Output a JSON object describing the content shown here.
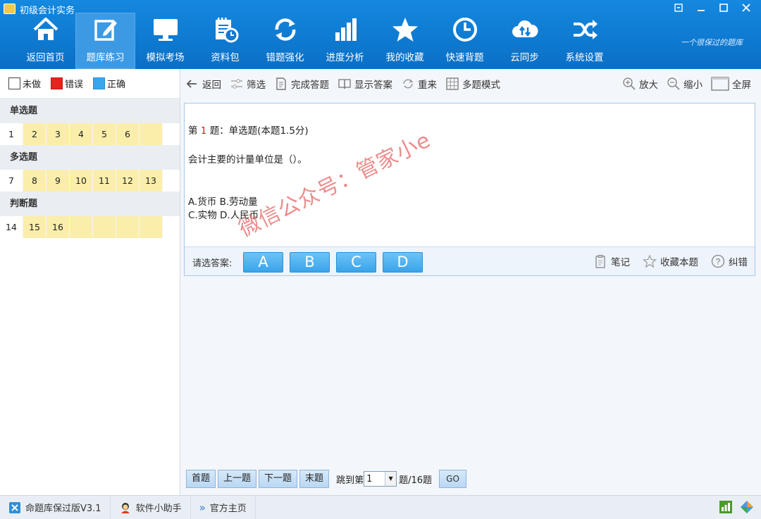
{
  "window": {
    "title": "初级会计实务",
    "controls": [
      "restore-down-icon",
      "minimize-icon",
      "maximize-icon",
      "close-icon"
    ]
  },
  "nav": {
    "items": [
      {
        "label": "返回首页",
        "icon": "home-icon"
      },
      {
        "label": "题库练习",
        "icon": "edit-icon",
        "active": true
      },
      {
        "label": "模拟考场",
        "icon": "monitor-icon"
      },
      {
        "label": "资料包",
        "icon": "notebook-clock-icon"
      },
      {
        "label": "错题强化",
        "icon": "refresh-icon"
      },
      {
        "label": "进度分析",
        "icon": "bar-chart-icon"
      },
      {
        "label": "我的收藏",
        "icon": "star-icon"
      },
      {
        "label": "快速背题",
        "icon": "clock-icon"
      },
      {
        "label": "云同步",
        "icon": "cloud-sync-icon"
      },
      {
        "label": "系统设置",
        "icon": "shuffle-icon"
      }
    ],
    "slogan": "一个很保过的题库"
  },
  "legend": {
    "unanswered": "未做",
    "wrong": "错误",
    "correct": "正确",
    "colors": {
      "wrong": "#e8221c",
      "correct": "#3aa6ec",
      "unanswered": "#ffffff"
    }
  },
  "sections": [
    {
      "title": "单选题",
      "questions": [
        "1",
        "2",
        "3",
        "4",
        "5",
        "6",
        ""
      ]
    },
    {
      "title": "多选题",
      "questions": [
        "7",
        "8",
        "9",
        "10",
        "11",
        "12",
        "13"
      ]
    },
    {
      "title": "判断题",
      "questions": [
        "14",
        "15",
        "16",
        "",
        "",
        "",
        ""
      ]
    }
  ],
  "toolbar": {
    "back": "返回",
    "filter": "筛选",
    "finish": "完成答题",
    "show_answer": "显示答案",
    "redo": "重来",
    "multi_mode": "多题模式",
    "zoom_in": "放大",
    "zoom_out": "缩小",
    "fullscreen": "全屏"
  },
  "question": {
    "prefix": "第",
    "number": "1",
    "suffix": "题：单选题(本题1.5分)",
    "stem": "会计主要的计量单位是（）。",
    "options_line1": "A.货币 B.劳动量",
    "options_line2": "C.实物 D.人民币"
  },
  "answer_bar": {
    "label": "请选答案:",
    "choices": [
      "A",
      "B",
      "C",
      "D"
    ],
    "notes": "笔记",
    "favorite": "收藏本题",
    "report": "纠错"
  },
  "watermark": "微信公众号：管家小e",
  "pager": {
    "first": "首题",
    "prev": "上一题",
    "next": "下一题",
    "last": "末题",
    "jump_prefix": "跳到第",
    "current_page": "1",
    "jump_suffix": "题/16题",
    "go": "GO"
  },
  "statusbar": {
    "version": "命题库保过版V3.1",
    "assistant": "软件小助手",
    "homepage": "官方主页"
  }
}
